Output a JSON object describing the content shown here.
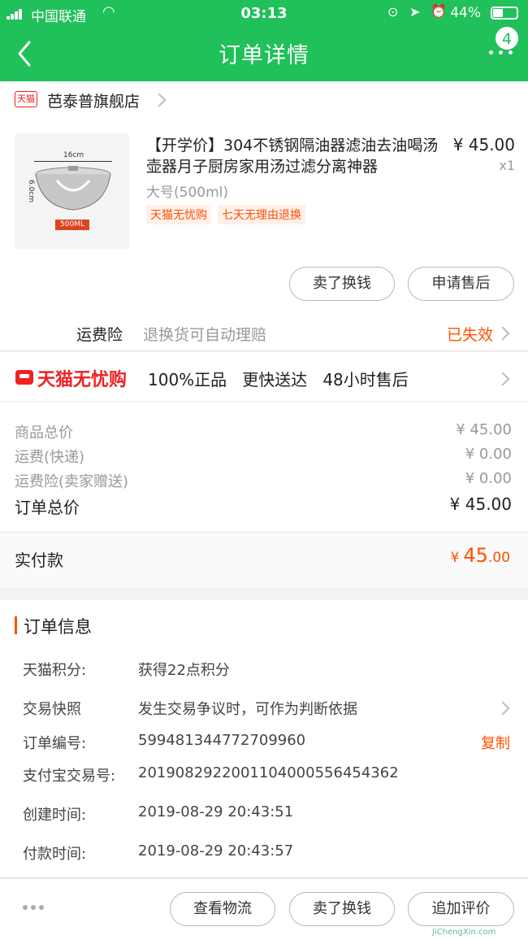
{
  "status_bar": {
    "carrier": "中国联通",
    "time": "03:13",
    "battery": "44%",
    "battery_level": 0.44
  },
  "nav": {
    "title": "订单详情",
    "badge_count": "4"
  },
  "store": {
    "logo_text": "天猫",
    "name": "芭泰普旗舰店"
  },
  "product": {
    "title": "【开学价】304不锈钢隔油器滤油去油喝汤壶器月子厨房家用汤过滤分离神器",
    "variant": "大号(500ml)",
    "price": "¥ 45.00",
    "quantity": "x1",
    "tags": [
      "天猫无忧购",
      "七天无理由退换"
    ],
    "image_labels": {
      "width": "16cm",
      "height": "6.0cm",
      "size": "500ML"
    },
    "buttons": {
      "sell": "卖了换钱",
      "after_sale": "申请售后"
    }
  },
  "insurance": {
    "label": "运费险",
    "desc": "退换货可自动理赔",
    "status": "已失效"
  },
  "worry_free": {
    "brand": "天猫无忧购",
    "features": "100%正品   更快送达   48小时售后"
  },
  "summary": {
    "rows": [
      {
        "label": "商品总价",
        "value": "¥ 45.00"
      },
      {
        "label": "运费(快递)",
        "value": "¥ 0.00"
      },
      {
        "label": "运费险(卖家赠送)",
        "value": "¥ 0.00"
      }
    ],
    "total_label": "订单总价",
    "total_value": "¥ 45.00",
    "paid_label": "实付款",
    "paid_currency": "¥",
    "paid_int": "45",
    "paid_dec": ".00"
  },
  "order_info": {
    "section_title": "订单信息",
    "points_label": "天猫积分:",
    "points_value": "获得22点积分",
    "snapshot_label": "交易快照",
    "snapshot_value": "发生交易争议时，可作为判断依据",
    "order_no_label": "订单编号:",
    "order_no_value": "599481344772709960",
    "copy_label": "复制",
    "alipay_label": "支付宝交易号:",
    "alipay_value": "2019082922001104000556454362",
    "created_label": "创建时间:",
    "created_value": "2019-08-29 20:43:51",
    "paid_time_label": "付款时间:",
    "paid_time_value": "2019-08-29 20:43:57"
  },
  "footer": {
    "logistics": "查看物流",
    "sell": "卖了换钱",
    "review": "追加评价",
    "watermark": "JiChengXin.com"
  }
}
